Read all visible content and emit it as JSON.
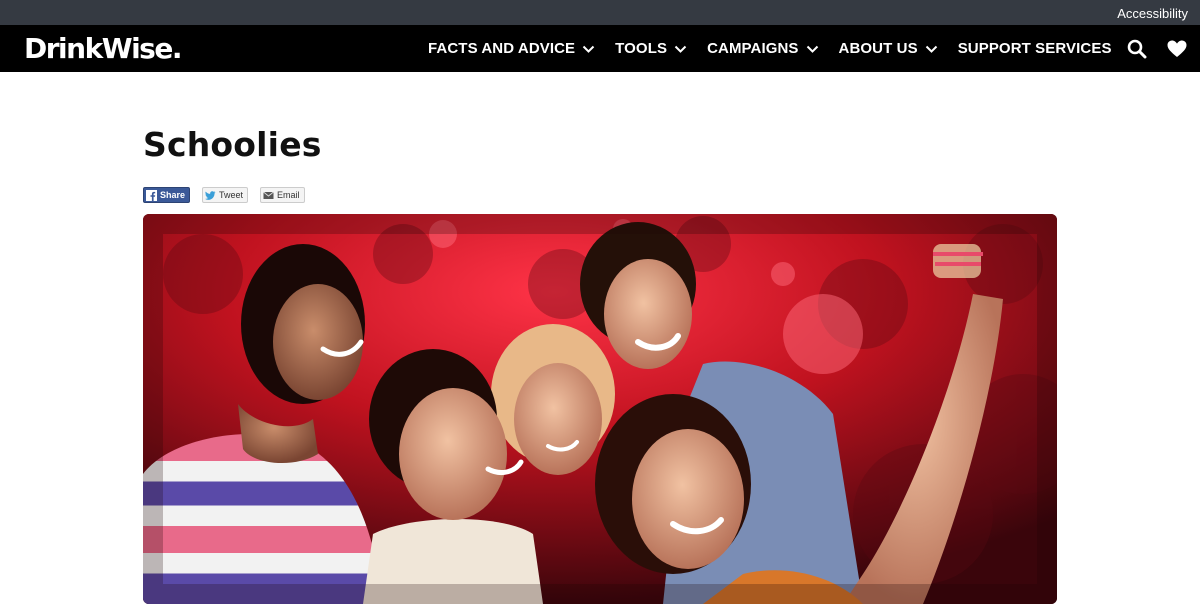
{
  "utility": {
    "accessibility_label": "Accessibility"
  },
  "header": {
    "logo_text": "DrinkWise.",
    "nav": [
      {
        "label": "FACTS AND ADVICE",
        "has_dropdown": true
      },
      {
        "label": "TOOLS",
        "has_dropdown": true
      },
      {
        "label": "CAMPAIGNS",
        "has_dropdown": true
      },
      {
        "label": "ABOUT US",
        "has_dropdown": true
      },
      {
        "label": "SUPPORT SERVICES",
        "has_dropdown": false
      }
    ],
    "icons": [
      "search-icon",
      "heart-icon"
    ]
  },
  "page": {
    "title": "Schoolies",
    "share": {
      "facebook_label": "Share",
      "twitter_label": "Tweet",
      "email_label": "Email"
    }
  },
  "colors": {
    "utility_bar": "#353a42",
    "nav_bar": "#000000",
    "facebook": "#3b5998",
    "hero_glow": "#d9142a"
  }
}
